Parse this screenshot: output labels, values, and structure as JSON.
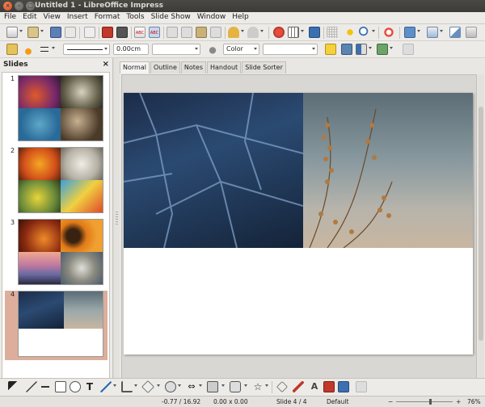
{
  "window": {
    "title": "Untitled 1 - LibreOffice Impress"
  },
  "menu": [
    "File",
    "Edit",
    "View",
    "Insert",
    "Format",
    "Tools",
    "Slide Show",
    "Window",
    "Help"
  ],
  "format_toolbar": {
    "line_width_value": "0.00cm",
    "area_style_value": "Color"
  },
  "slides_pane": {
    "title": "Slides",
    "close_glyph": "×",
    "slides": [
      {
        "number": "1"
      },
      {
        "number": "2"
      },
      {
        "number": "3"
      },
      {
        "number": "4",
        "selected": true
      }
    ]
  },
  "view_tabs": [
    "Normal",
    "Outline",
    "Notes",
    "Handout",
    "Slide Sorter"
  ],
  "active_tab": "Normal",
  "status": {
    "position": "-0.77 / 16.92",
    "size": "0.00 x 0.00",
    "slide": "Slide 4 / 4",
    "layout": "Default",
    "zoom": "76%"
  },
  "colors": {
    "titlebar": "#3c3b37",
    "close_button": "#e0531e",
    "selected_slide": "#dcae9b"
  }
}
